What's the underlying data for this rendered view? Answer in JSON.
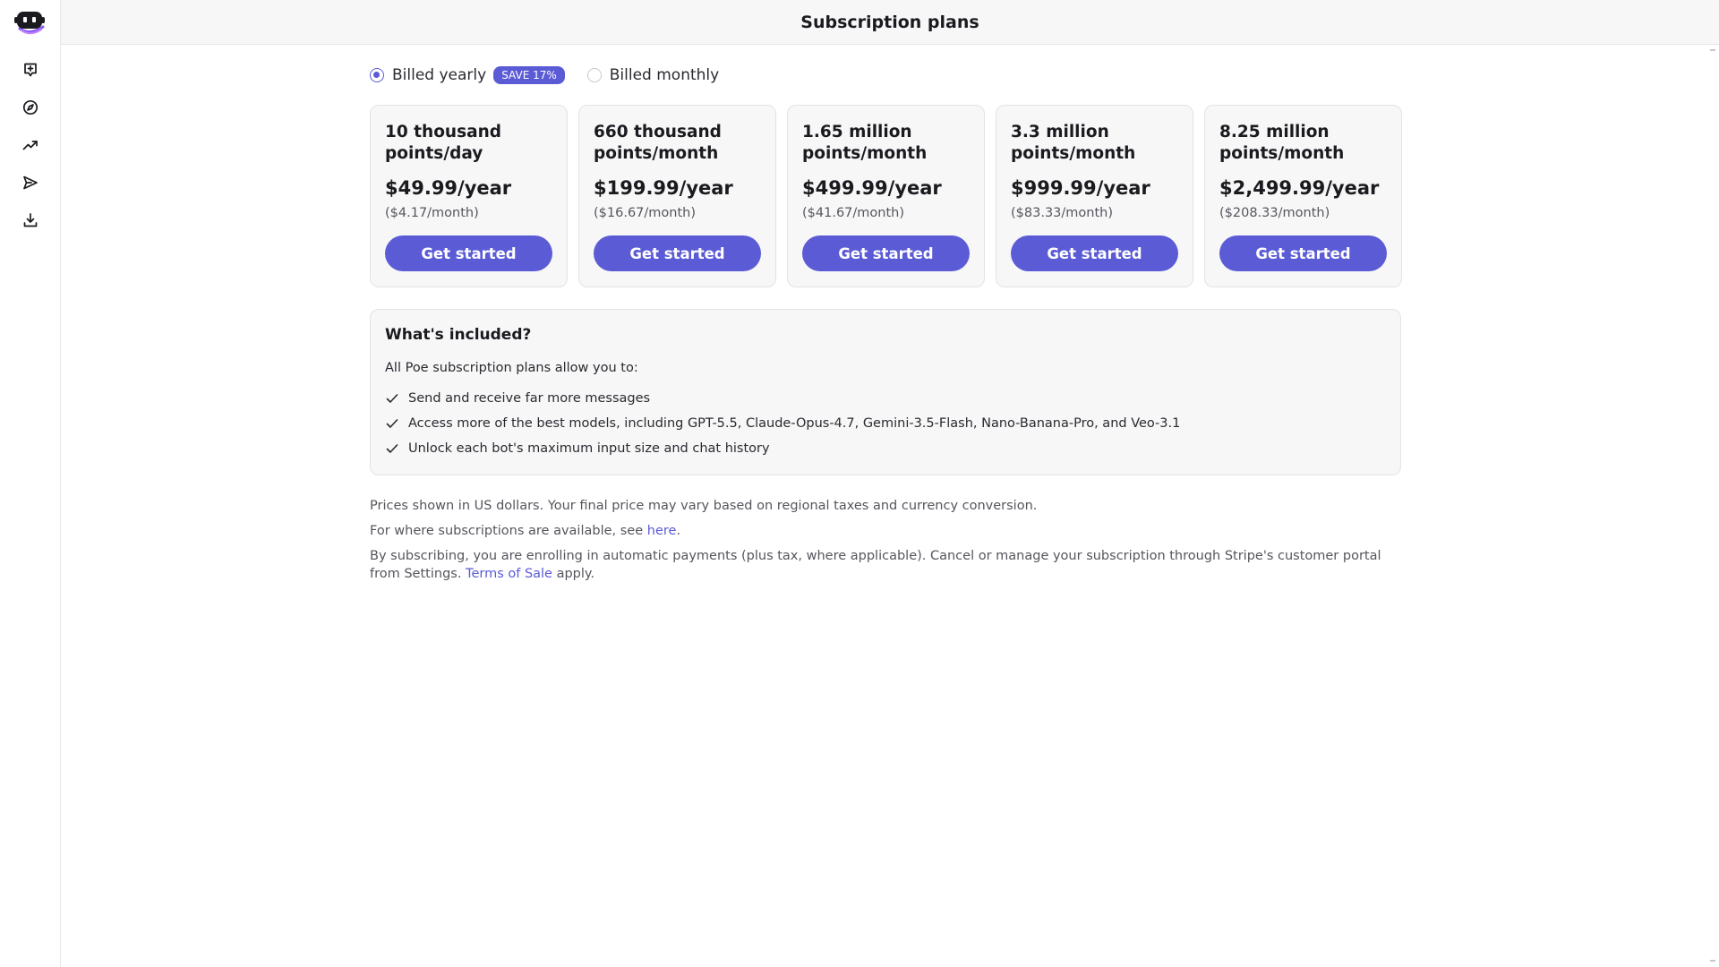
{
  "header": {
    "title": "Subscription plans"
  },
  "sidebar": {
    "items": [
      {
        "name": "new-chat",
        "icon": "new-chat-icon"
      },
      {
        "name": "explore",
        "icon": "compass-icon"
      },
      {
        "name": "trending",
        "icon": "trending-up-icon"
      },
      {
        "name": "send",
        "icon": "send-icon"
      },
      {
        "name": "download",
        "icon": "download-icon"
      }
    ]
  },
  "billing": {
    "yearly_label": "Billed yearly",
    "save_badge": "SAVE 17%",
    "monthly_label": "Billed monthly",
    "selected": "yearly"
  },
  "plans": [
    {
      "name": "10 thousand points/day",
      "price": "$49.99/year",
      "monthly": "($4.17/month)",
      "cta": "Get started"
    },
    {
      "name": "660 thousand points/month",
      "price": "$199.99/year",
      "monthly": "($16.67/month)",
      "cta": "Get started"
    },
    {
      "name": "1.65 million points/month",
      "price": "$499.99/year",
      "monthly": "($41.67/month)",
      "cta": "Get started"
    },
    {
      "name": "3.3 million points/month",
      "price": "$999.99/year",
      "monthly": "($83.33/month)",
      "cta": "Get started"
    },
    {
      "name": "8.25 million points/month",
      "price": "$2,499.99/year",
      "monthly": "($208.33/month)",
      "cta": "Get started"
    }
  ],
  "included": {
    "title": "What's included?",
    "intro": "All Poe subscription plans allow you to:",
    "features": [
      "Send and receive far more messages",
      "Access more of the best models, including GPT-5.5, Claude-Opus-4.7, Gemini-3.5-Flash, Nano-Banana-Pro, and Veo-3.1",
      "Unlock each bot's maximum input size and chat history"
    ]
  },
  "notes": {
    "currency": "Prices shown in US dollars. Your final price may vary based on regional taxes and currency conversion.",
    "availability_prefix": "For where subscriptions are available, see ",
    "availability_link": "here",
    "availability_suffix": ".",
    "terms_prefix": "By subscribing, you are enrolling in automatic payments (plus tax, where applicable). Cancel or manage your subscription through Stripe's customer portal from Settings. ",
    "terms_link": "Terms of Sale",
    "terms_suffix": " apply."
  },
  "colors": {
    "accent": "#5b5bd6",
    "panel": "#f7f7f8",
    "border": "#e3e3e8"
  }
}
